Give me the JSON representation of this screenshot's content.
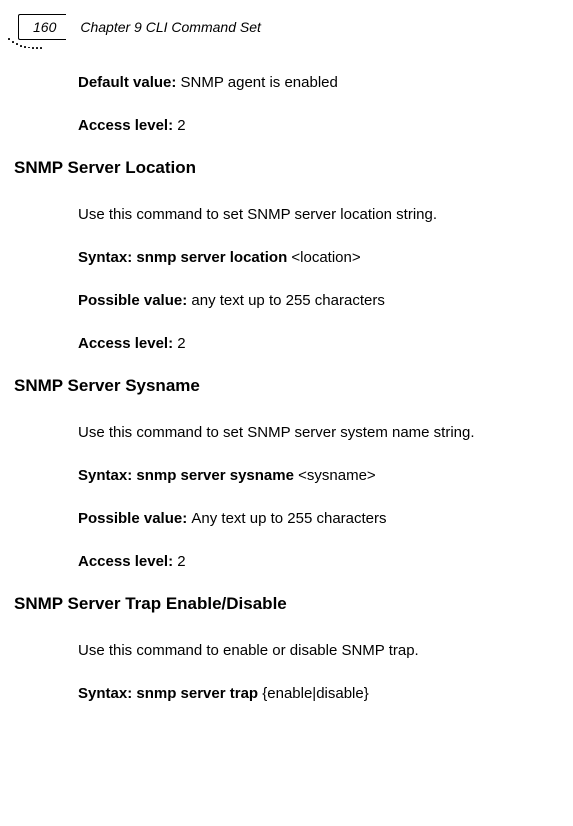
{
  "header": {
    "page_number": "160",
    "chapter_title": "Chapter 9 CLI Command Set"
  },
  "blocks": [
    {
      "type": "para",
      "parts": [
        {
          "bold": true,
          "text": "Default value: "
        },
        {
          "bold": false,
          "text": "SNMP agent is enabled"
        }
      ]
    },
    {
      "type": "para",
      "parts": [
        {
          "bold": true,
          "text": "Access level: "
        },
        {
          "bold": false,
          "text": "2"
        }
      ]
    },
    {
      "type": "heading",
      "text": "SNMP Server Location"
    },
    {
      "type": "para",
      "parts": [
        {
          "bold": false,
          "text": "Use this command to set SNMP server location string."
        }
      ]
    },
    {
      "type": "para",
      "parts": [
        {
          "bold": true,
          "text": "Syntax: snmp server location "
        },
        {
          "bold": false,
          "text": "<location>"
        }
      ]
    },
    {
      "type": "para",
      "parts": [
        {
          "bold": true,
          "text": "Possible value: "
        },
        {
          "bold": false,
          "text": "any text up to 255 characters"
        }
      ]
    },
    {
      "type": "para",
      "parts": [
        {
          "bold": true,
          "text": "Access level: "
        },
        {
          "bold": false,
          "text": "2"
        }
      ]
    },
    {
      "type": "heading",
      "text": "SNMP Server Sysname"
    },
    {
      "type": "para",
      "parts": [
        {
          "bold": false,
          "text": "Use this command to set SNMP server system name string."
        }
      ]
    },
    {
      "type": "para",
      "parts": [
        {
          "bold": true,
          "text": "Syntax: snmp server sysname "
        },
        {
          "bold": false,
          "text": "<sysname>"
        }
      ]
    },
    {
      "type": "para",
      "parts": [
        {
          "bold": true,
          "text": "Possible value: "
        },
        {
          "bold": false,
          "text": "Any text up to 255 characters"
        }
      ]
    },
    {
      "type": "para",
      "parts": [
        {
          "bold": true,
          "text": "Access level: "
        },
        {
          "bold": false,
          "text": "2"
        }
      ]
    },
    {
      "type": "heading",
      "text": "SNMP Server Trap Enable/Disable"
    },
    {
      "type": "para",
      "parts": [
        {
          "bold": false,
          "text": "Use this command to enable or disable SNMP trap."
        }
      ]
    },
    {
      "type": "para",
      "parts": [
        {
          "bold": true,
          "text": "Syntax: snmp server trap "
        },
        {
          "bold": false,
          "text": "{enable|disable}"
        }
      ]
    }
  ]
}
